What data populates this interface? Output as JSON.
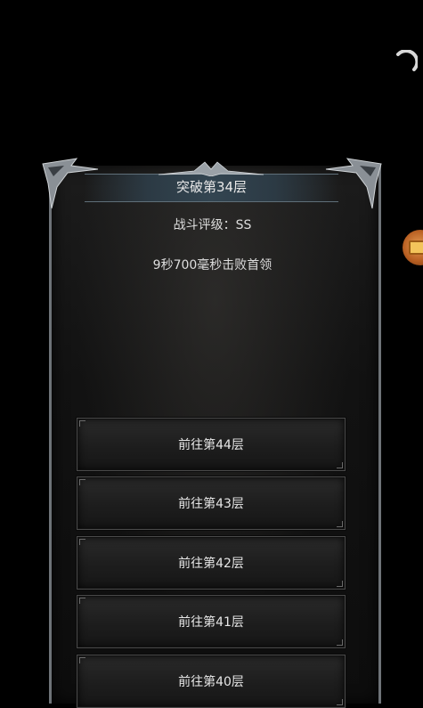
{
  "dialog": {
    "title": "突破第34层",
    "rating": "战斗评级：SS",
    "clear_time": "9秒700毫秒击败首领",
    "floor_buttons": [
      {
        "label": "前往第44层"
      },
      {
        "label": "前往第43层"
      },
      {
        "label": "前往第42层"
      },
      {
        "label": "前往第41层"
      },
      {
        "label": "前往第40层"
      }
    ]
  },
  "colors": {
    "background": "#000000",
    "title_bar": "#334551",
    "button": "#1d1d1d",
    "text": "#e6e6e6",
    "side_bubble": "#c36a2a"
  },
  "icons": {
    "loading": "loading-spinner-icon",
    "side": "treasure-chest-icon"
  }
}
